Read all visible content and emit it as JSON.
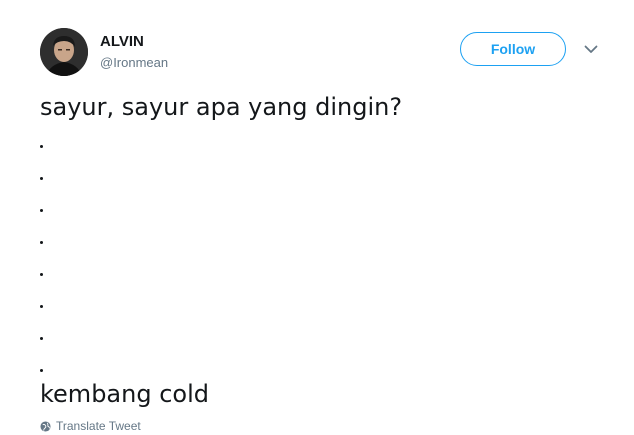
{
  "user": {
    "display_name": "ALVIN",
    "handle": "@Ironmean"
  },
  "follow_button": {
    "label": "Follow"
  },
  "menu": {
    "icon": "chevron-down-icon"
  },
  "tweet": {
    "first_line": "sayur, sayur apa yang dingin?",
    "dots": [
      ".",
      ".",
      ".",
      ".",
      ".",
      ".",
      ".",
      "."
    ],
    "punchline": "kembang cold"
  },
  "translate": {
    "icon": "globe-icon",
    "label": "Translate Tweet"
  },
  "colors": {
    "accent": "#1da1f2",
    "text": "#14171a",
    "secondary": "#657786"
  }
}
